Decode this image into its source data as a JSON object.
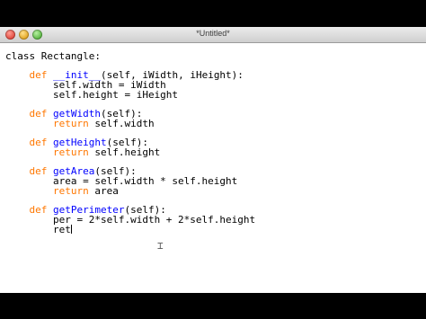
{
  "window": {
    "title": "*Untitled*"
  },
  "colors": {
    "keyword": "#ff7700",
    "function_name": "#0000ff",
    "text": "#000000",
    "background": "#ffffff"
  },
  "code": {
    "lines": [
      {
        "text": "class Rectangle:"
      },
      {
        "text": ""
      },
      {
        "indent": "    ",
        "kw": "def",
        "fn": "__init__",
        "rest": "(self, iWidth, iHeight):"
      },
      {
        "text": "        self.width = iWidth"
      },
      {
        "text": "        self.height = iHeight"
      },
      {
        "text": ""
      },
      {
        "indent": "    ",
        "kw": "def",
        "fn": "getWidth",
        "rest": "(self):"
      },
      {
        "indent": "        ",
        "kw": "return",
        "rest": " self.width"
      },
      {
        "text": ""
      },
      {
        "indent": "    ",
        "kw": "def",
        "fn": "getHeight",
        "rest": "(self):"
      },
      {
        "indent": "        ",
        "kw": "return",
        "rest": " self.height"
      },
      {
        "text": ""
      },
      {
        "indent": "    ",
        "kw": "def",
        "fn": "getArea",
        "rest": "(self):"
      },
      {
        "text": "        area = self.width * self.height"
      },
      {
        "indent": "        ",
        "kw": "return",
        "rest": " area"
      },
      {
        "text": ""
      },
      {
        "indent": "    ",
        "kw": "def",
        "fn": "getPerimeter",
        "rest": "(self):"
      },
      {
        "text": "        per = 2*self.width + 2*self.height"
      },
      {
        "text": "        ret",
        "caret": true
      }
    ]
  }
}
